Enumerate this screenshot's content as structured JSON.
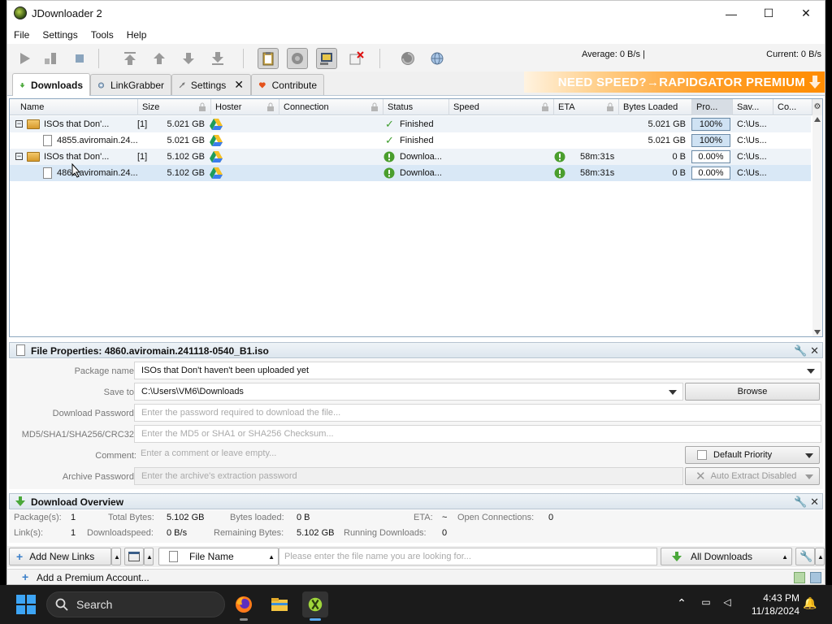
{
  "window": {
    "title": "JDownloader 2",
    "minimize": "—",
    "maximize": "☐",
    "close": "✕"
  },
  "menu": [
    "File",
    "Settings",
    "Tools",
    "Help"
  ],
  "toolbar": {
    "average_speed": "Average: 0 B/s |",
    "current_speed": "Current: 0 B/s"
  },
  "tabs": {
    "downloads": "Downloads",
    "linkgrabber": "LinkGrabber",
    "settings": "Settings",
    "settings_close": "✕",
    "contribute": "Contribute",
    "banner": "NEED SPEED?→RAPIDGATOR PREMIUM"
  },
  "table": {
    "headers": [
      "Name",
      "Size",
      "Hoster",
      "Connection",
      "Status",
      "Speed",
      "ETA",
      "Bytes Loaded",
      "Pro...",
      "Sav...",
      "Co..."
    ],
    "settings_icon": "⚙",
    "rows": [
      {
        "type": "package",
        "expander": "−",
        "name": "ISOs that Don'...",
        "count": "[1]",
        "size": "5.021 GB",
        "status": "Finished",
        "eta": "",
        "bytes": "5.021 GB",
        "progress": "100%",
        "progress_fraction": 1.0,
        "save": "C:\\Us..."
      },
      {
        "type": "link",
        "name": "4855.aviromain.24...",
        "count": "",
        "size": "5.021 GB",
        "status": "Finished",
        "eta": "",
        "bytes": "5.021 GB",
        "progress": "100%",
        "progress_fraction": 1.0,
        "save": "C:\\Us..."
      },
      {
        "type": "package",
        "expander": "−",
        "name": "ISOs that Don'...",
        "count": "[1]",
        "size": "5.102 GB",
        "status": "Downloa...",
        "eta": "58m:31s",
        "bytes": "0 B",
        "progress": "0.00%",
        "progress_fraction": 0.0,
        "save": "C:\\Us..."
      },
      {
        "type": "link",
        "name": "4860.aviromain.24...",
        "count": "",
        "size": "5.102 GB",
        "status": "Downloa...",
        "eta": "58m:31s",
        "bytes": "0 B",
        "progress": "0.00%",
        "progress_fraction": 0.0,
        "save": "C:\\Us..."
      }
    ]
  },
  "file_properties": {
    "title": "File Properties: 4860.aviromain.241118-0540_B1.iso",
    "package_name_label": "Package name:",
    "package_name": "ISOs that Don't haven't been uploaded yet",
    "save_to_label": "Save to:",
    "save_to": "C:\\Users\\VM6\\Downloads",
    "browse": "Browse",
    "password_label": "Download Password:",
    "password_placeholder": "Enter the password required to download the file...",
    "checksum_label": "MD5/SHA1/SHA256/CRC32:",
    "checksum_placeholder": "Enter the MD5 or SHA1 or SHA256 Checksum...",
    "comment_label": "Comment:",
    "comment_placeholder": "Enter a comment or leave empty...",
    "priority": "Default Priority",
    "archive_label": "Archive Password:",
    "archive_placeholder": "Enter the archive's extraction password",
    "auto_extract": "Auto Extract Disabled"
  },
  "overview": {
    "title": "Download Overview",
    "packages_label": "Package(s):",
    "packages": "1",
    "total_bytes_label": "Total Bytes:",
    "total_bytes": "5.102 GB",
    "bytes_loaded_label": "Bytes loaded:",
    "bytes_loaded": "0 B",
    "eta_label": "ETA:",
    "eta": "~",
    "open_conn_label": "Open Connections:",
    "open_conn": "0",
    "links_label": "Link(s):",
    "links": "1",
    "dl_speed_label": "Downloadspeed:",
    "dl_speed": "0 B/s",
    "remaining_label": "Remaining Bytes:",
    "remaining": "5.102 GB",
    "running_label": "Running Downloads:",
    "running": "0"
  },
  "bottom": {
    "add_links": "Add New Links",
    "file_name": "File Name",
    "search_placeholder": "Please enter the file name you are looking for...",
    "all_downloads": "All Downloads",
    "premium": "Add a Premium Account..."
  },
  "taskbar": {
    "search": "Search",
    "time": "4:43 PM",
    "date": "11/18/2024"
  },
  "colors": {
    "accent": "#3da5f5",
    "banner_orange": "#ff8c00",
    "selected_row": "#d9e8f6",
    "finished_green": "#3f9d2f"
  }
}
